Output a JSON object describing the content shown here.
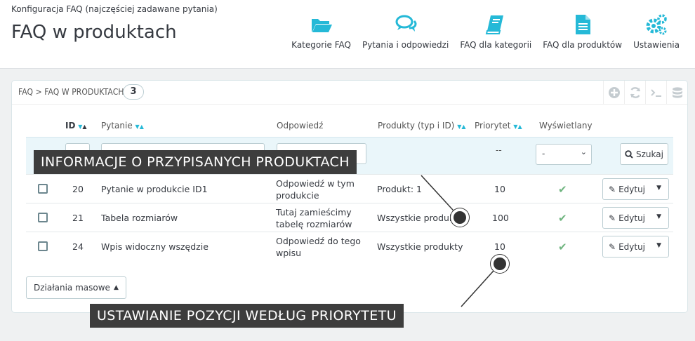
{
  "header": {
    "breadcrumb": "Konfiguracja FAQ (najczęściej zadawane pytania)",
    "title": "FAQ w produktach",
    "toolbar": [
      {
        "label": "Kategorie FAQ",
        "icon": "folder-open-icon"
      },
      {
        "label": "Pytania i odpowiedzi",
        "icon": "chat-bubbles-icon"
      },
      {
        "label": "FAQ dla kategorii",
        "icon": "book-icon"
      },
      {
        "label": "FAQ dla produktów",
        "icon": "document-icon"
      },
      {
        "label": "Ustawienia",
        "icon": "gears-icon"
      }
    ]
  },
  "panel": {
    "title": "FAQ > FAQ W PRODUKTACH",
    "count": "3",
    "columns": {
      "id": "ID",
      "question": "Pytanie",
      "answer": "Odpowiedź",
      "products": "Produkty (typ i ID)",
      "priority": "Priorytet",
      "displayed": "Wyświetlany"
    },
    "filters": {
      "priority_placeholder": "--",
      "displayed_value": "-",
      "search_label": "Szukaj"
    },
    "rows": [
      {
        "id": "20",
        "question": "Pytanie w produkcie ID1",
        "answer_l1": "Odpowiedź w tym",
        "answer_l2": "produkcie",
        "products": "Produkt: 1",
        "priority": "10",
        "edit": "Edytuj"
      },
      {
        "id": "21",
        "question": "Tabela rozmiarów",
        "answer_l1": "Tutaj zamieścimy",
        "answer_l2": "tabelę rozmiarów",
        "products": "Wszystkie produkty",
        "priority": "100",
        "edit": "Edytuj"
      },
      {
        "id": "24",
        "question": "Wpis widoczny wszędzie",
        "answer_l1": "Odpowiedź do tego",
        "answer_l2": "wpisu",
        "products": "Wszystkie produkty",
        "priority": "10",
        "edit": "Edytuj"
      }
    ],
    "bulk_label": "Działania masowe"
  },
  "callouts": {
    "products_info": "INFORMACJE O PRZYPISANYCH PRODUKTACH",
    "priority_info": "USTAWIANIE POZYCJI WEDŁUG PRIORYTETU"
  },
  "colors": {
    "accent": "#25b9d7",
    "ok": "#70b580",
    "callout_bg": "#3d3d3d"
  }
}
